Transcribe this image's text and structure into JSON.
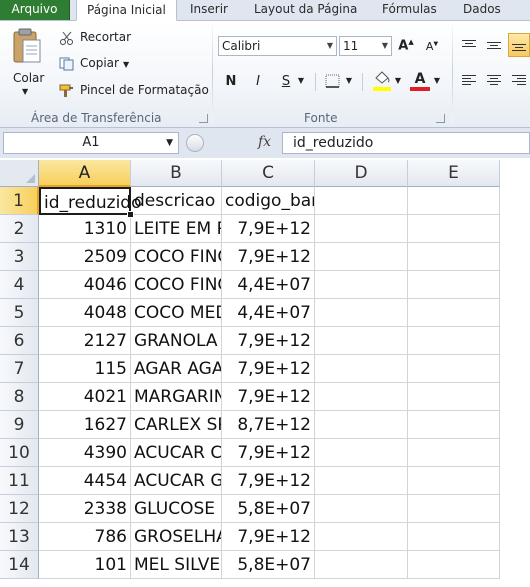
{
  "ribbon_tabs": {
    "file": "Arquivo",
    "home": "Página Inicial",
    "insert": "Inserir",
    "page_layout": "Layout da Página",
    "formulas": "Fórmulas",
    "data": "Dados"
  },
  "clipboard": {
    "paste": "Colar",
    "cut": "Recortar",
    "copy": "Copiar",
    "format_painter": "Pincel de Formatação",
    "group_label": "Área de Transferência"
  },
  "font": {
    "name": "Calibri",
    "size": "11",
    "bold": "N",
    "italic": "I",
    "underline": "S",
    "group_label": "Fonte",
    "highlight_color": "#ffff00",
    "text_color": "#e02020"
  },
  "formula_bar": {
    "name_box": "A1",
    "fx": "fx",
    "value": "id_reduzido"
  },
  "columns": [
    "A",
    "B",
    "C",
    "D",
    "E"
  ],
  "rows": [
    "1",
    "2",
    "3",
    "4",
    "5",
    "6",
    "7",
    "8",
    "9",
    "10",
    "11",
    "12",
    "13",
    "14"
  ],
  "cells": {
    "header": [
      "id_reduzido",
      "descricao",
      "codigo_barras"
    ],
    "ids": [
      "1310",
      "2509",
      "4046",
      "4048",
      "2127",
      "115",
      "4021",
      "1627",
      "4390",
      "4454",
      "2338",
      "786",
      "101"
    ],
    "descricao": [
      "LEITE EM P",
      "COCO FINO",
      "COCO FINO",
      "COCO MED",
      "GRANOLA",
      "AGAR AGA",
      "MARGARIN",
      "CARLEX SP",
      "ACUCAR C",
      "ACUCAR G",
      "GLUCOSE L",
      "GROSELHA",
      "MEL SILVE"
    ],
    "codigo_barras": [
      "7,9E+12",
      "7,9E+12",
      "4,4E+07",
      "4,4E+07",
      "7,9E+12",
      "7,9E+12",
      "7,9E+12",
      "8,7E+12",
      "7,9E+12",
      "7,9E+12",
      "5,8E+07",
      "7,9E+12",
      "5,8E+07"
    ]
  },
  "accent": {
    "file_tab": "#2e7d32",
    "selected_header": "#f8cf5c"
  }
}
